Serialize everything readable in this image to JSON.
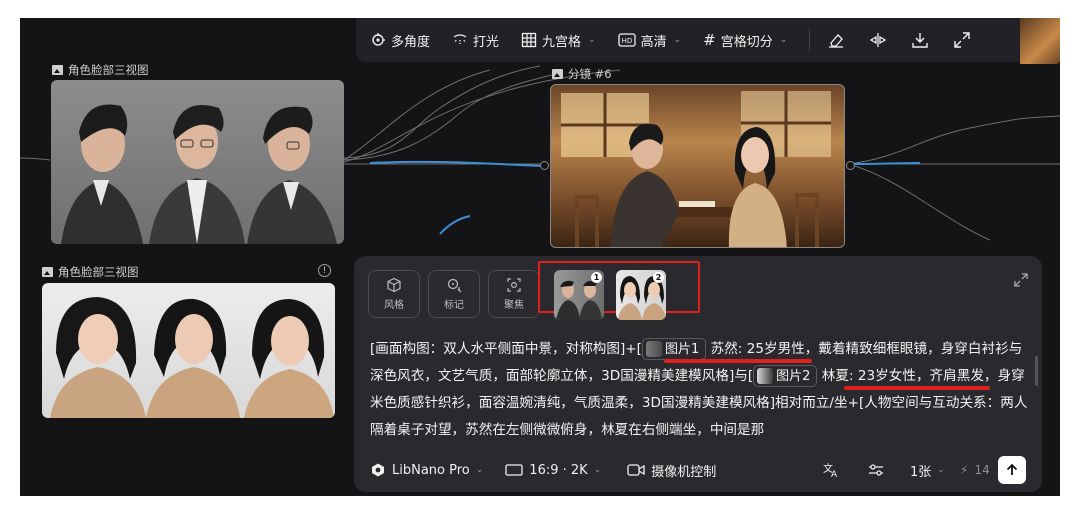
{
  "toolbar": {
    "items": [
      {
        "label": "多角度",
        "icon": "rotate-icon"
      },
      {
        "label": "打光",
        "icon": "light-icon"
      },
      {
        "label": "九宫格",
        "icon": "grid-icon",
        "dropdown": true
      },
      {
        "label": "高清",
        "icon": "hd-icon",
        "dropdown": true
      },
      {
        "label": "宫格切分",
        "icon": "hash-icon",
        "dropdown": true
      }
    ],
    "right_icons": [
      "eraser-icon",
      "flip-icon",
      "download-icon",
      "fullscreen-icon"
    ]
  },
  "nodes": {
    "face_views_male": {
      "caption": "角色脸部三视图"
    },
    "face_views_female": {
      "caption": "角色脸部三视图"
    },
    "shot": {
      "caption": "分镜 #6"
    }
  },
  "panel": {
    "tools": [
      {
        "label": "风格",
        "icon": "cube-icon"
      },
      {
        "label": "标记",
        "icon": "marker-icon"
      },
      {
        "label": "聚焦",
        "icon": "focus-icon"
      }
    ],
    "refs": [
      "1",
      "2"
    ],
    "prompt": {
      "p1": "[画面构图：双人水平侧面中景，对称构图]+[",
      "chip1": "图片1",
      "p2": " 苏然: 25岁男性，戴着精致细框眼镜，身穿白衬衫与深色风衣，文艺气质，面部轮廓立体，3D国漫精美建模风格]与[",
      "chip2": "图片2",
      "p3": " 林夏: 23岁女性，齐肩黑发，身穿米色质感针织衫，面容温婉清纯，气质温柔，3D国漫精美建模风格]相对而立/坐+[人物空间与互动关系：两人隔着桌子对望，苏然在左侧微微俯身，林夏在右侧端坐，中间是那"
    },
    "bottom": {
      "model": "LibNano Pro",
      "aspect": "16:9 · 2K",
      "camera": "摄像机控制",
      "count": "1张",
      "credits": "14"
    }
  },
  "colors": {
    "accent_red": "#e0201c",
    "wire_blue": "#3f8fd6",
    "canvas_bg": "#141416"
  }
}
